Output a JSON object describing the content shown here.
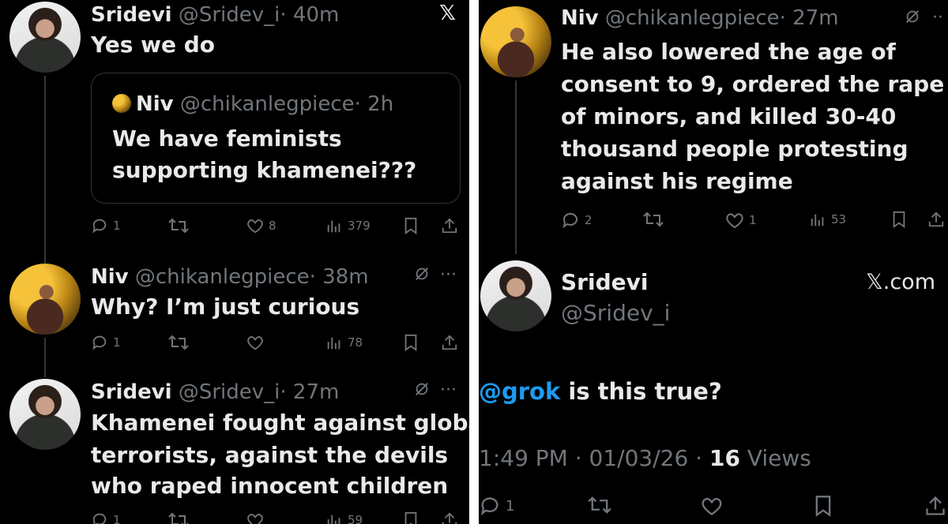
{
  "left": {
    "tweet1": {
      "name": "Sridevi",
      "handle": "@Sridev_i",
      "time": "· 40m",
      "text": "Yes we do",
      "quote": {
        "name": "Niv",
        "handle": "@chikanlegpiece",
        "time": "· 2h",
        "lines": [
          "We have feminists",
          "supporting khamenei???"
        ]
      },
      "replies": "1",
      "likes": "8",
      "views": "379"
    },
    "tweet2": {
      "name": "Niv",
      "handle": "@chikanlegpiece",
      "time": "· 38m",
      "text": "Why? I’m just curious",
      "replies": "1",
      "views": "78"
    },
    "tweet3": {
      "name": "Sridevi",
      "handle": "@Sridev_i",
      "time": "· 27m",
      "lines": [
        "Khamenei fought against global",
        "terrorists, against the devils",
        "who raped innocent children"
      ],
      "replies": "1",
      "views": "59"
    }
  },
  "right": {
    "tweet4": {
      "name": "Niv",
      "handle": "@chikanlegpiece",
      "time": "· 27m",
      "lines": [
        "He also lowered the age of",
        "consent to 9, ordered the rape",
        "of minors, and killed 30-40",
        "thousand people protesting",
        "against his regime"
      ],
      "replies": "2",
      "likes": "1",
      "views": "53"
    },
    "main": {
      "name": "Sridevi",
      "handle": "@Sridev_i",
      "brand": "𝕏.com",
      "mention": "@grok",
      "text": " is this true?",
      "timestamp": "1:49 PM · 01/03/26 · ",
      "views_count": "16",
      "views_label": " Views",
      "replies": "1"
    }
  },
  "icons": [
    "x-logo-icon",
    "reply-icon",
    "retweet-icon",
    "like-icon",
    "views-icon",
    "bookmark-icon",
    "share-icon",
    "grok-icon",
    "more-icon"
  ]
}
